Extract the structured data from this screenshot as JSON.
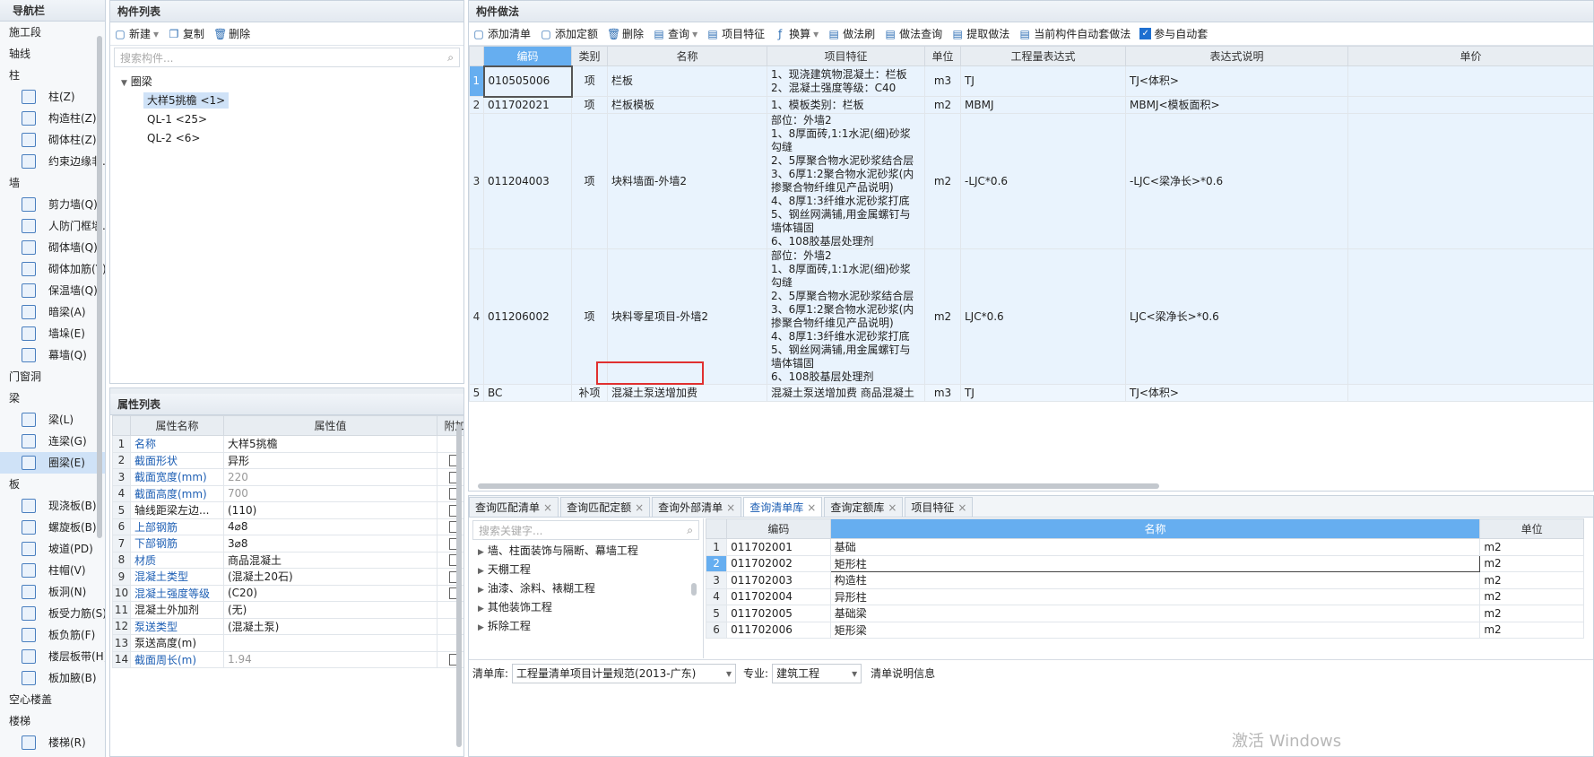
{
  "nav": {
    "title": "导航栏",
    "items": [
      {
        "t": "sec",
        "label": "施工段"
      },
      {
        "t": "sec",
        "label": "轴线"
      },
      {
        "t": "sec",
        "label": "柱"
      },
      {
        "t": "item",
        "label": "柱(Z)"
      },
      {
        "t": "item",
        "label": "构造柱(Z)"
      },
      {
        "t": "item",
        "label": "砌体柱(Z)"
      },
      {
        "t": "item",
        "label": "约束边缘非..."
      },
      {
        "t": "sec",
        "label": "墙"
      },
      {
        "t": "item",
        "label": "剪力墙(Q)"
      },
      {
        "t": "item",
        "label": "人防门框墙..."
      },
      {
        "t": "item",
        "label": "砌体墙(Q)"
      },
      {
        "t": "item",
        "label": "砌体加筋(Y)"
      },
      {
        "t": "item",
        "label": "保温墙(Q)"
      },
      {
        "t": "item",
        "label": "暗梁(A)"
      },
      {
        "t": "item",
        "label": "墙垛(E)"
      },
      {
        "t": "item",
        "label": "幕墙(Q)"
      },
      {
        "t": "sec",
        "label": "门窗洞"
      },
      {
        "t": "sec",
        "label": "梁"
      },
      {
        "t": "item",
        "label": "梁(L)"
      },
      {
        "t": "item",
        "label": "连梁(G)"
      },
      {
        "t": "item",
        "label": "圈梁(E)",
        "sel": true
      },
      {
        "t": "sec",
        "label": "板"
      },
      {
        "t": "item",
        "label": "现浇板(B)"
      },
      {
        "t": "item",
        "label": "螺旋板(B)"
      },
      {
        "t": "item",
        "label": "坡道(PD)"
      },
      {
        "t": "item",
        "label": "柱帽(V)"
      },
      {
        "t": "item",
        "label": "板洞(N)"
      },
      {
        "t": "item",
        "label": "板受力筋(S)"
      },
      {
        "t": "item",
        "label": "板负筋(F)"
      },
      {
        "t": "item",
        "label": "楼层板带(H)"
      },
      {
        "t": "item",
        "label": "板加腋(B)"
      },
      {
        "t": "sec",
        "label": "空心楼盖"
      },
      {
        "t": "sec",
        "label": "楼梯"
      },
      {
        "t": "item",
        "label": "楼梯(R)"
      }
    ]
  },
  "complist": {
    "title": "构件列表",
    "new": "新建",
    "copy": "复制",
    "del": "删除",
    "search_ph": "搜索构件...",
    "root": "圈梁",
    "nodes": [
      "大样5挑檐 <1>",
      "QL-1 <25>",
      "QL-2 <6>"
    ]
  },
  "props": {
    "title": "属性列表",
    "headers": [
      "属性名称",
      "属性值",
      "附加"
    ],
    "rows": [
      {
        "n": "1",
        "name": "名称",
        "val": "大样5挑檐",
        "blue": true,
        "cb": false,
        "gray": false
      },
      {
        "n": "2",
        "name": "截面形状",
        "val": "异形",
        "blue": true,
        "cb": true,
        "gray": false
      },
      {
        "n": "3",
        "name": "截面宽度(mm)",
        "val": "220",
        "blue": true,
        "cb": true,
        "gray": true
      },
      {
        "n": "4",
        "name": "截面高度(mm)",
        "val": "700",
        "blue": true,
        "cb": true,
        "gray": true
      },
      {
        "n": "5",
        "name": "轴线距梁左边...",
        "val": "(110)",
        "blue": false,
        "cb": true,
        "gray": false
      },
      {
        "n": "6",
        "name": "上部钢筋",
        "val": "4⌀8",
        "blue": true,
        "cb": true,
        "gray": false
      },
      {
        "n": "7",
        "name": "下部钢筋",
        "val": "3⌀8",
        "blue": true,
        "cb": true,
        "gray": false
      },
      {
        "n": "8",
        "name": "材质",
        "val": "商品混凝土",
        "blue": true,
        "cb": true,
        "gray": false
      },
      {
        "n": "9",
        "name": "混凝土类型",
        "val": "(混凝土20石)",
        "blue": true,
        "cb": true,
        "gray": false
      },
      {
        "n": "10",
        "name": "混凝土强度等级",
        "val": "(C20)",
        "blue": true,
        "cb": true,
        "gray": false
      },
      {
        "n": "11",
        "name": "混凝土外加剂",
        "val": "(无)",
        "blue": false,
        "cb": false,
        "gray": false
      },
      {
        "n": "12",
        "name": "泵送类型",
        "val": "(混凝土泵)",
        "blue": true,
        "cb": false,
        "gray": false
      },
      {
        "n": "13",
        "name": "泵送高度(m)",
        "val": "",
        "blue": false,
        "cb": false,
        "gray": false
      },
      {
        "n": "14",
        "name": "截面周长(m)",
        "val": "1.94",
        "blue": true,
        "cb": true,
        "gray": true
      }
    ]
  },
  "method": {
    "title": "构件做法",
    "tools": [
      "添加清单",
      "添加定额",
      "删除",
      "查询",
      "项目特征",
      "换算",
      "做法刷",
      "做法查询",
      "提取做法",
      "当前构件自动套做法",
      "参与自动套"
    ],
    "headers": [
      "编码",
      "类别",
      "名称",
      "项目特征",
      "单位",
      "工程量表达式",
      "表达式说明",
      "单价"
    ],
    "rows": [
      {
        "n": "1",
        "code": "010505006",
        "type": "项",
        "name": "栏板",
        "feat": "1、现浇建筑物混凝土：栏板\n2、混凝土强度等级：C40",
        "unit": "m3",
        "expr": "TJ",
        "desc": "TJ<体积>"
      },
      {
        "n": "2",
        "code": "011702021",
        "type": "项",
        "name": "栏板模板",
        "feat": "1、模板类别：栏板",
        "unit": "m2",
        "expr": "MBMJ",
        "desc": "MBMJ<模板面积>"
      },
      {
        "n": "3",
        "code": "011204003",
        "type": "项",
        "name": "块料墙面-外墙2",
        "feat": "部位：外墙2\n1、8厚面砖,1:1水泥(细)砂浆勾缝\n2、5厚聚合物水泥砂浆结合层\n3、6厚1:2聚合物水泥砂浆(内掺聚合物纤维见产品说明)\n4、8厚1:3纤维水泥砂浆打底\n5、钢丝网满铺,用金属螺钉与墙体锚固\n6、108胶基层处理剂",
        "unit": "m2",
        "expr": "-LJC*0.6",
        "desc": "-LJC<梁净长>*0.6"
      },
      {
        "n": "4",
        "code": "011206002",
        "type": "项",
        "name": "块料零星项目-外墙2",
        "feat": "部位：外墙2\n1、8厚面砖,1:1水泥(细)砂浆勾缝\n2、5厚聚合物水泥砂浆结合层\n3、6厚1:2聚合物水泥砂浆(内掺聚合物纤维见产品说明)\n4、8厚1:3纤维水泥砂浆打底\n5、钢丝网满铺,用金属螺钉与墙体锚固\n6、108胶基层处理剂",
        "unit": "m2",
        "expr": "LJC*0.6",
        "desc": "LJC<梁净长>*0.6"
      },
      {
        "n": "5",
        "code": "BC",
        "type": "补项",
        "name": "混凝土泵送增加费",
        "feat": "混凝土泵送增加费 商品混凝土",
        "unit": "m3",
        "expr": "TJ",
        "desc": "TJ<体积>"
      }
    ]
  },
  "query": {
    "tabs": [
      "查询匹配清单",
      "查询匹配定额",
      "查询外部清单",
      "查询清单库",
      "查询定额库",
      "项目特征"
    ],
    "active": 3,
    "search_ph": "搜索关键字...",
    "tree": [
      "墙、柱面装饰与隔断、幕墙工程",
      "天棚工程",
      "油漆、涂料、裱糊工程",
      "其他装饰工程",
      "拆除工程"
    ],
    "headers": [
      "编码",
      "名称",
      "单位"
    ],
    "rows": [
      {
        "n": "1",
        "code": "011702001",
        "name": "基础",
        "unit": "m2"
      },
      {
        "n": "2",
        "code": "011702002",
        "name": "矩形柱",
        "unit": "m2"
      },
      {
        "n": "3",
        "code": "011702003",
        "name": "构造柱",
        "unit": "m2"
      },
      {
        "n": "4",
        "code": "011702004",
        "name": "异形柱",
        "unit": "m2"
      },
      {
        "n": "5",
        "code": "011702005",
        "name": "基础梁",
        "unit": "m2"
      },
      {
        "n": "6",
        "code": "011702006",
        "name": "矩形梁",
        "unit": "m2"
      }
    ],
    "lib_label": "清单库:",
    "lib_val": "工程量清单项目计量规范(2013-广东)",
    "spec_label": "专业:",
    "spec_val": "建筑工程",
    "info": "清单说明信息"
  },
  "watermark": "激活 Windows",
  "colors": {
    "accent": "#1e5fb4",
    "highlight": "#e03030",
    "header_sel": "#66aef0"
  }
}
